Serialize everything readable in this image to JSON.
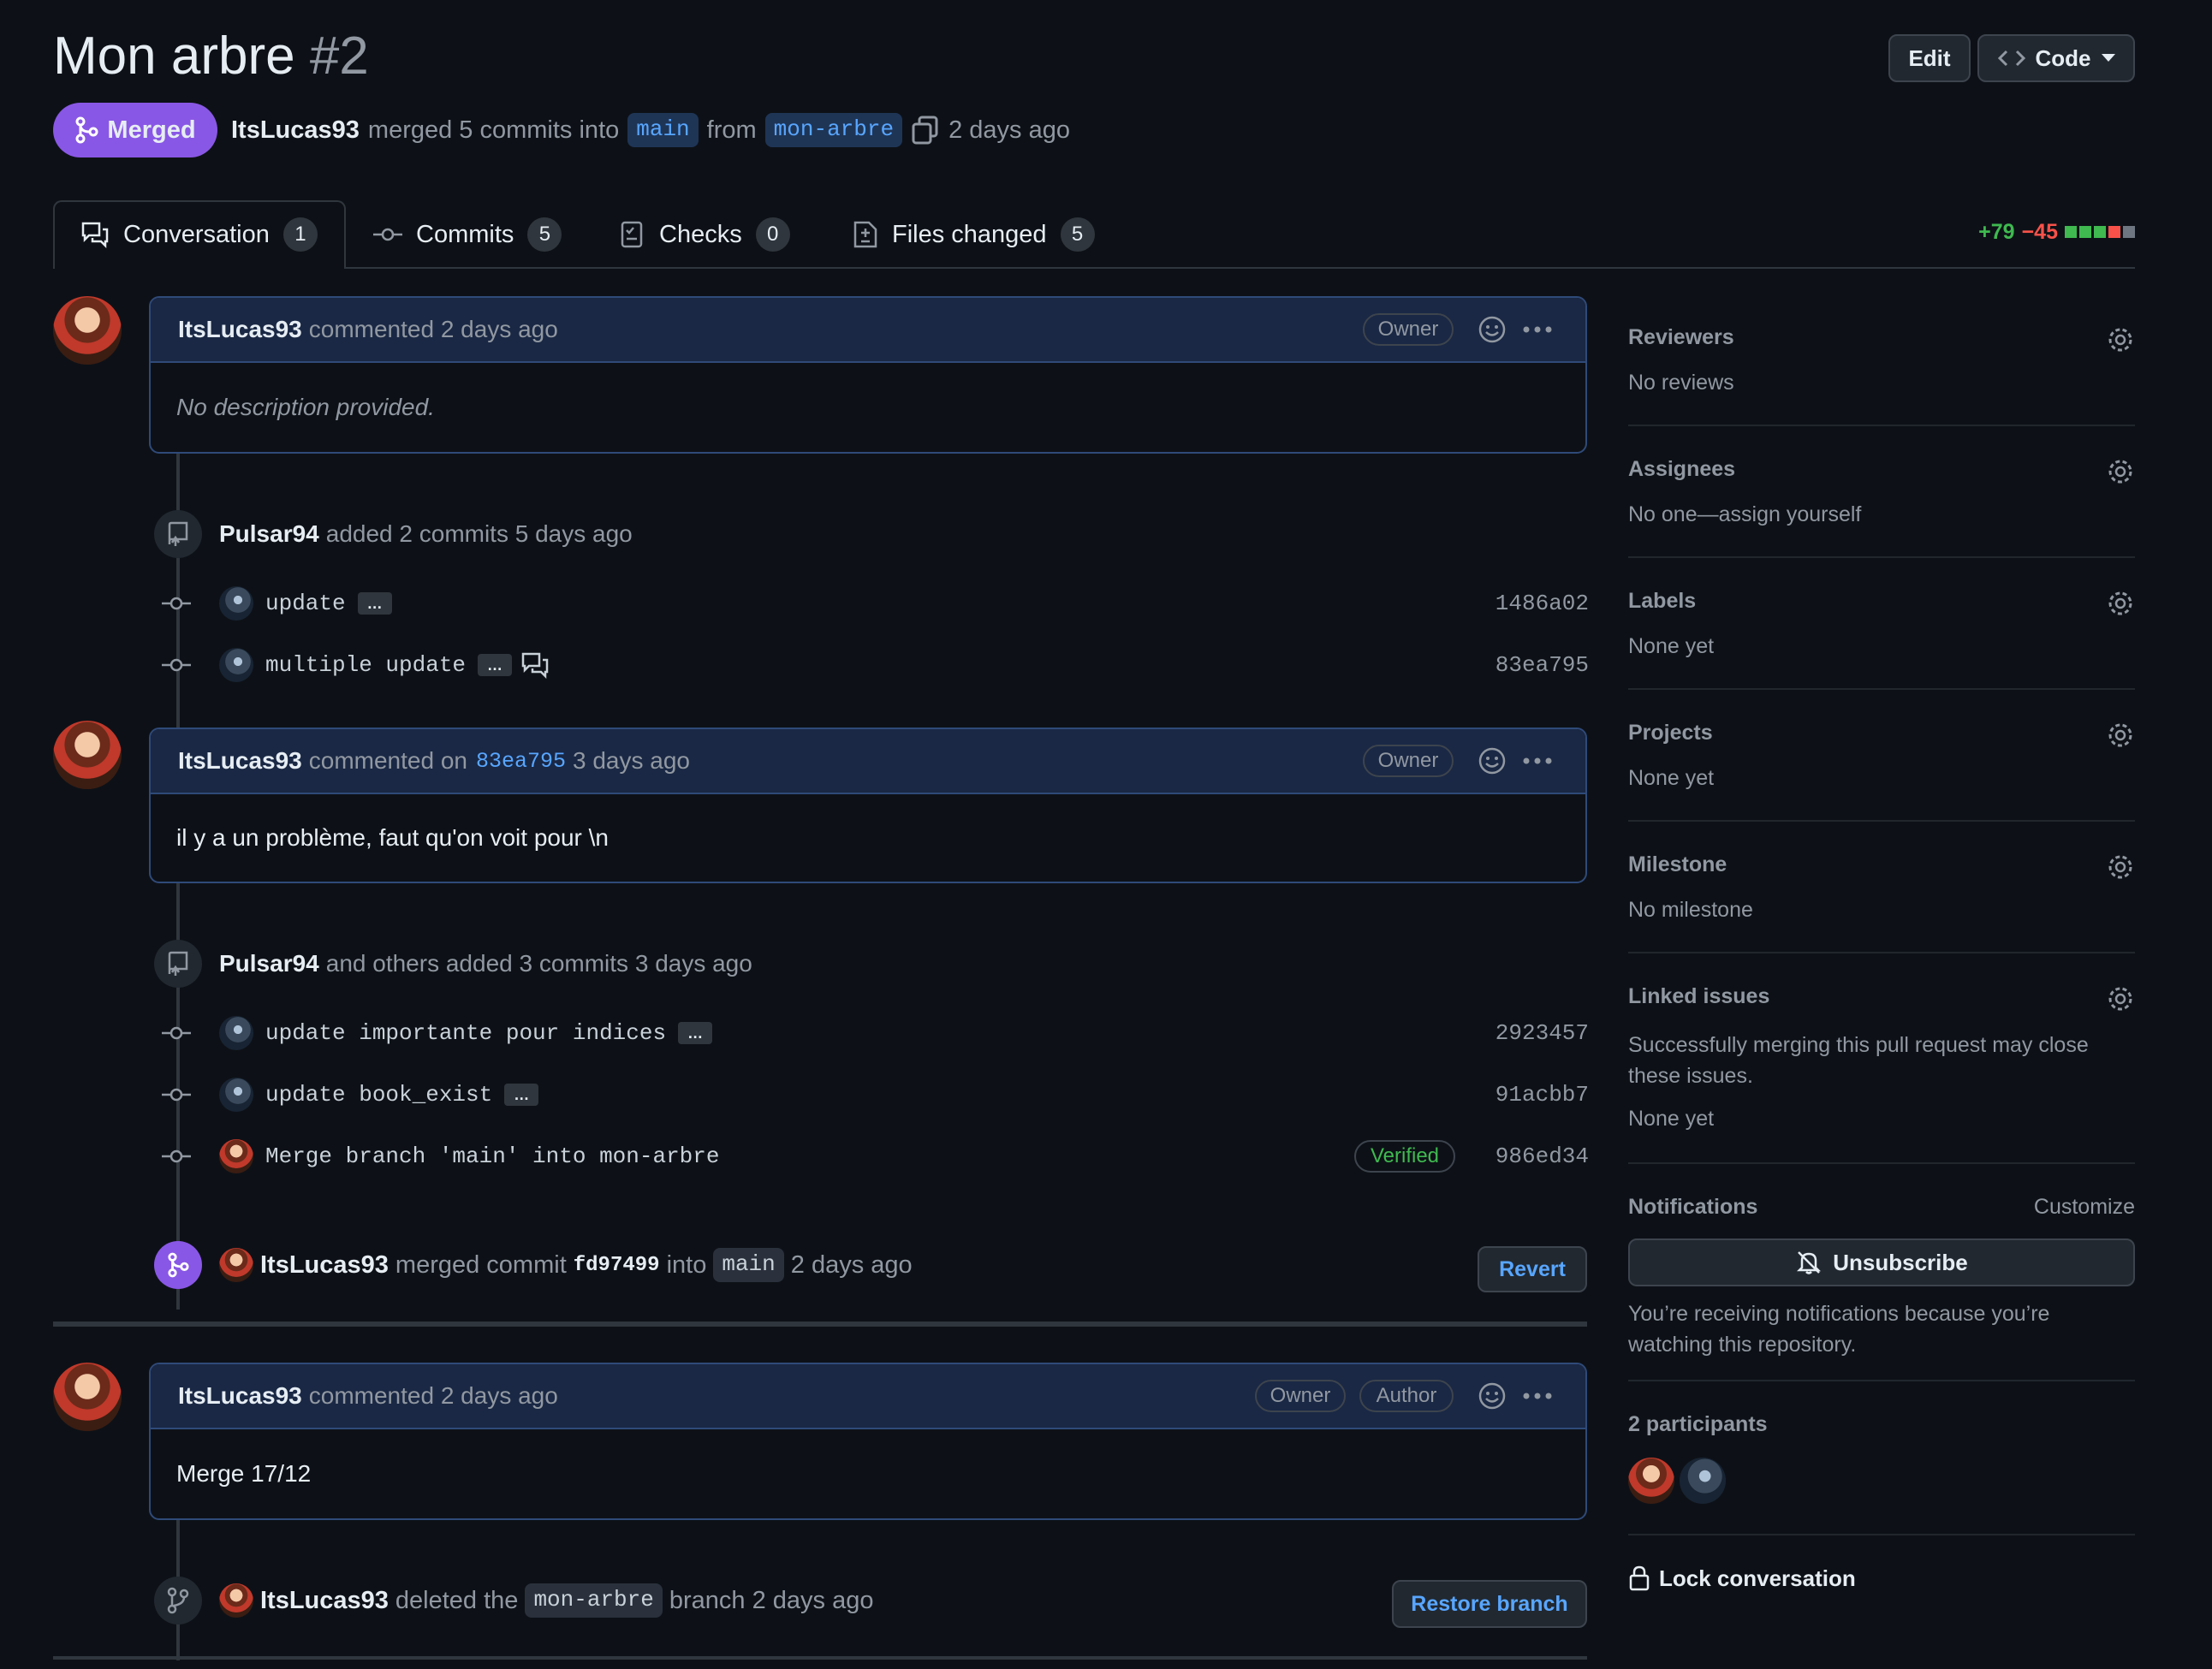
{
  "header": {
    "title": "Mon arbre",
    "number": "#2",
    "edit_label": "Edit",
    "code_label": "Code",
    "status": "Merged",
    "merge_author": "ItsLucas93",
    "merge_text": "merged 5 commits into",
    "base_branch": "main",
    "from_text": "from",
    "head_branch": "mon-arbre",
    "time": "2 days ago"
  },
  "tabs": [
    {
      "label": "Conversation",
      "count": "1"
    },
    {
      "label": "Commits",
      "count": "5"
    },
    {
      "label": "Checks",
      "count": "0"
    },
    {
      "label": "Files changed",
      "count": "5"
    }
  ],
  "diffstat": {
    "added": "+79",
    "removed": "−45"
  },
  "comments": [
    {
      "author": "ItsLucas93",
      "action": "commented 2 days ago",
      "badges": [
        "Owner"
      ],
      "body": "No description provided."
    },
    {
      "author": "ItsLucas93",
      "action": "commented on",
      "ref": "83ea795",
      "time": "3 days ago",
      "badges": [
        "Owner"
      ],
      "body": "il y a un problème, faut qu'on voit pour \\n"
    },
    {
      "author": "ItsLucas93",
      "action": "commented 2 days ago",
      "badges": [
        "Owner",
        "Author"
      ],
      "body": "Merge 17/12"
    }
  ],
  "commit_groups": [
    {
      "author": "Pulsar94",
      "text": "added 2 commits 5 days ago",
      "commits": [
        {
          "message": "update",
          "sha": "1486a02"
        },
        {
          "message": "multiple update",
          "sha": "83ea795"
        }
      ]
    },
    {
      "author": "Pulsar94",
      "text": "and others added 3 commits 3 days ago",
      "commits": [
        {
          "message": "update importante pour indices",
          "sha": "2923457"
        },
        {
          "message": "update book_exist",
          "sha": "91acbb7"
        },
        {
          "message": "Merge branch 'main' into mon-arbre",
          "sha": "986ed34",
          "verified": "Verified"
        }
      ]
    }
  ],
  "merge_event": {
    "author": "ItsLucas93",
    "text1": "merged commit",
    "commit": "fd97499",
    "text2": "into",
    "branch": "main",
    "time": "2 days ago",
    "button": "Revert"
  },
  "delete_event": {
    "author": "ItsLucas93",
    "text1": "deleted the",
    "branch": "mon-arbre",
    "text2": "branch 2 days ago",
    "button": "Restore branch"
  },
  "sidebar": {
    "reviewers": {
      "title": "Reviewers",
      "value": "No reviews"
    },
    "assignees": {
      "title": "Assignees",
      "value": "No one—assign yourself"
    },
    "labels": {
      "title": "Labels",
      "value": "None yet"
    },
    "projects": {
      "title": "Projects",
      "value": "None yet"
    },
    "milestone": {
      "title": "Milestone",
      "value": "No milestone"
    },
    "linked": {
      "title": "Linked issues",
      "desc": "Successfully merging this pull request may close these issues.",
      "value": "None yet"
    },
    "notifications": {
      "title": "Notifications",
      "customize": "Customize",
      "button": "Unsubscribe",
      "desc": "You’re receiving notifications because you’re watching this repository."
    },
    "participants": {
      "title": "2 participants"
    },
    "lock": "Lock conversation"
  },
  "colors": {
    "merged": "#8957e5",
    "link": "#58a6ff",
    "added": "#3fb950",
    "removed": "#f85149",
    "verified": "#3fb950"
  }
}
